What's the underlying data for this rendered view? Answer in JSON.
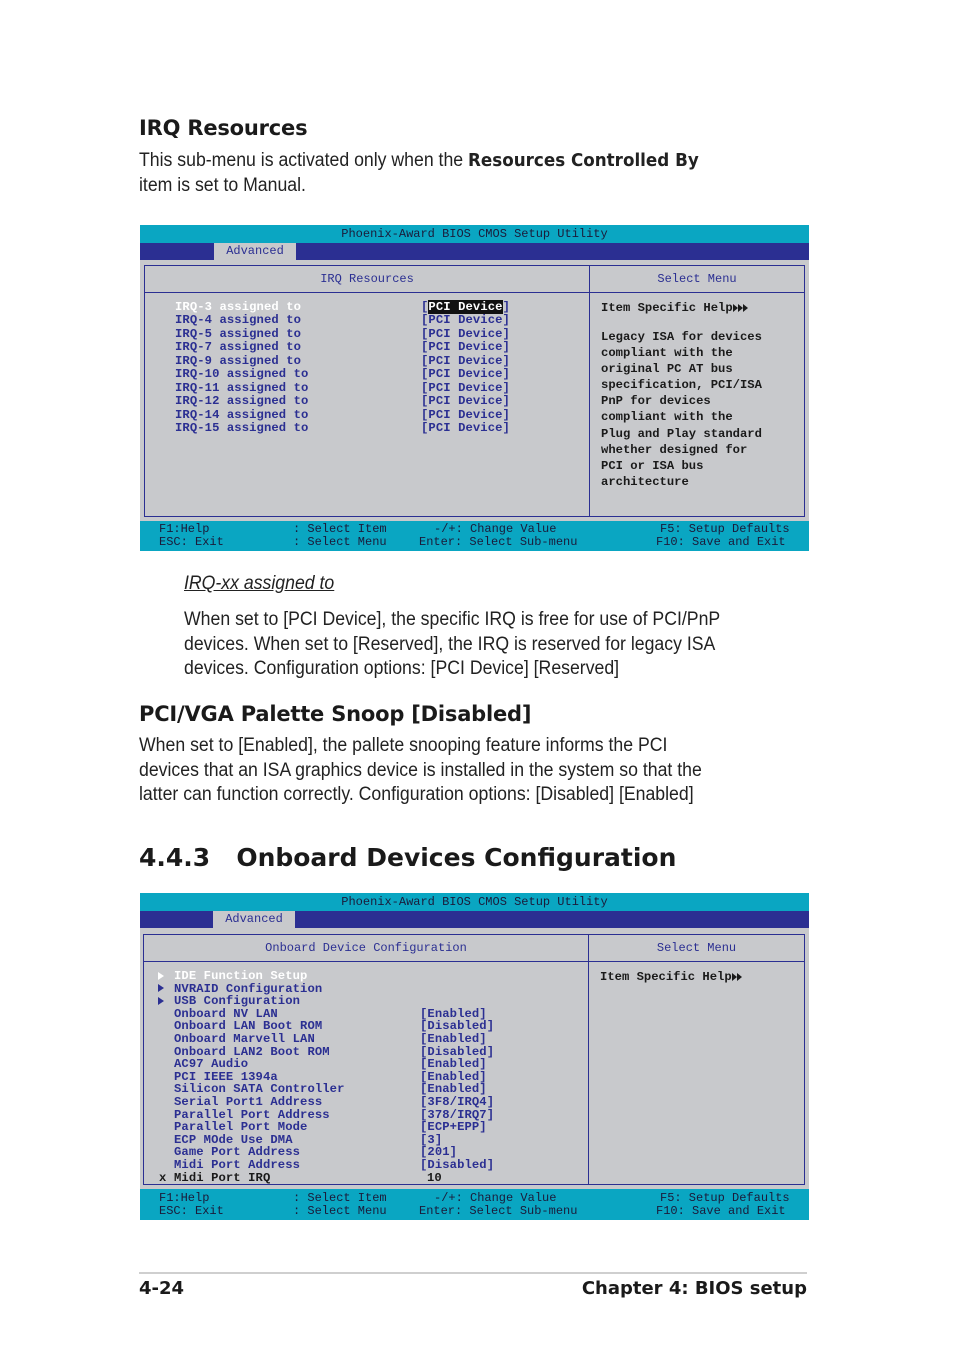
{
  "irq_section": {
    "heading": "IRQ Resources",
    "intro_prefix": "This sub-menu is activated only when the ",
    "intro_bold": "Resources Controlled By",
    "intro_line2": "item is set to Manual."
  },
  "bios1": {
    "title": "Phoenix-Award BIOS CMOS Setup Utility",
    "tab": "Advanced",
    "left_header": "IRQ Resources",
    "right_header": "Select Menu",
    "items": [
      {
        "label": "IRQ-3 assigned to",
        "value": "PCI Device",
        "selected": true
      },
      {
        "label": "IRQ-4 assigned to",
        "value": "[PCI Device]"
      },
      {
        "label": "IRQ-5 assigned to",
        "value": "[PCI Device]"
      },
      {
        "label": "IRQ-7 assigned to",
        "value": "[PCI Device]"
      },
      {
        "label": "IRQ-9 assigned to",
        "value": "[PCI Device]"
      },
      {
        "label": "IRQ-10 assigned to",
        "value": "[PCI Device]"
      },
      {
        "label": "IRQ-11 assigned to",
        "value": "[PCI Device]"
      },
      {
        "label": "IRQ-12 assigned to",
        "value": "[PCI Device]"
      },
      {
        "label": "IRQ-14 assigned to",
        "value": "[PCI Device]"
      },
      {
        "label": "IRQ-15 assigned to",
        "value": "[PCI Device]"
      }
    ],
    "help_title": "Item Specific Help",
    "help_lines": [
      "Legacy ISA for devices",
      "compliant with the",
      "original PC AT bus",
      "specification, PCI/ISA",
      "PnP for devices",
      "compliant with the",
      "Plug and Play standard",
      "whether designed for",
      "PCI or ISA bus",
      "architecture"
    ],
    "footer": {
      "f1": "F1:Help",
      "esc": "ESC: Exit",
      "select_item": ": Select Item",
      "select_menu": ": Select Menu",
      "change_value": "-/+: Change Value",
      "enter": "Enter: Select Sub-menu",
      "f5": "F5: Setup Defaults",
      "f10": "F10: Save and Exit"
    }
  },
  "irq_assigned": {
    "heading": "IRQ-xx assigned to",
    "lines": [
      "When set to [PCI Device], the specific IRQ is free for use of PCI/PnP",
      "devices. When set to [Reserved], the IRQ is reserved for legacy ISA",
      "devices. Configuration options: [PCI Device] [Reserved]"
    ]
  },
  "palette_snoop": {
    "heading": "PCI/VGA Palette Snoop [Disabled]",
    "lines": [
      "When set to [Enabled], the pallete snooping feature informs the PCI",
      "devices that an ISA graphics device is installed in the system so that the",
      "latter can function correctly. Configuration options: [Disabled] [Enabled]"
    ]
  },
  "onboard_section": {
    "number": "4.4.3",
    "title": "Onboard Devices Configuration"
  },
  "bios2": {
    "title": "Phoenix-Award BIOS CMOS Setup Utility",
    "tab": "Advanced",
    "left_header": "Onboard Device Configuration",
    "right_header": "Select Menu",
    "submenus": [
      {
        "label": "IDE Function Setup",
        "selected": true
      },
      {
        "label": "NVRAID Configuration"
      },
      {
        "label": "USB Configuration"
      }
    ],
    "items": [
      {
        "label": "Onboard NV LAN",
        "value": "[Enabled]"
      },
      {
        "label": "Onboard LAN Boot ROM",
        "value": "[Disabled]"
      },
      {
        "label": "Onboard Marvell LAN",
        "value": "[Enabled]"
      },
      {
        "label": "Onboard LAN2 Boot ROM",
        "value": "[Disabled]"
      },
      {
        "label": "AC97 Audio",
        "value": "[Enabled]"
      },
      {
        "label": "PCI IEEE 1394a",
        "value": "[Enabled]"
      },
      {
        "label": "Silicon SATA Controller",
        "value": "[Enabled]"
      },
      {
        "label": "Serial Port1 Address",
        "value": "[3F8/IRQ4]"
      },
      {
        "label": "Parallel Port Address",
        "value": "[378/IRQ7]"
      },
      {
        "label": "Parallel Port Mode",
        "value": "[ECP+EPP]"
      },
      {
        "label": "ECP MOde Use DMA",
        "value": "[3]"
      },
      {
        "label": "Game Port Address",
        "value": "[201]"
      },
      {
        "label": "Midi Port Address",
        "value": "[Disabled]"
      }
    ],
    "disabled_item": {
      "marker": "x",
      "label": "Midi Port IRQ",
      "value": "10"
    },
    "help_title": "Item Specific Help",
    "footer": {
      "f1": "F1:Help",
      "esc": "ESC: Exit",
      "select_item": ": Select Item",
      "select_menu": ": Select Menu",
      "change_value": "-/+: Change Value",
      "enter": "Enter: Select Sub-menu",
      "f5": "F5: Setup Defaults",
      "f10": "F10: Save and Exit"
    }
  },
  "page_footer": {
    "page_number": "4-24",
    "chapter": "Chapter 4: BIOS setup"
  }
}
